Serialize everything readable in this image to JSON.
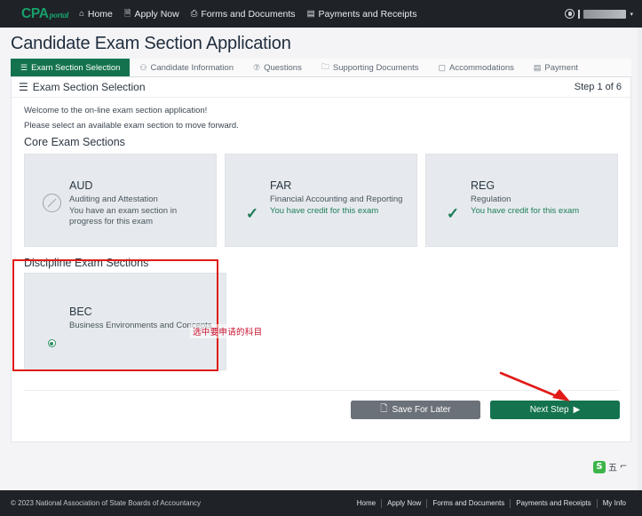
{
  "topnav": {
    "brand_main": "CPA",
    "brand_sub": "portal",
    "items": [
      {
        "icon": "⌂",
        "icon_name": "home-icon",
        "label": "Home"
      },
      {
        "icon": "🗎",
        "icon_name": "document-icon",
        "label": "Apply Now"
      },
      {
        "icon": "⎙",
        "icon_name": "forms-icon",
        "label": "Forms and Documents"
      },
      {
        "icon": "▤",
        "icon_name": "payments-icon",
        "label": "Payments and Receipts"
      }
    ],
    "account_name": "",
    "caret": "▾"
  },
  "page": {
    "title": "Candidate Exam Section Application"
  },
  "tabs": [
    {
      "icon": "☰",
      "label": "Exam Section Selection",
      "active": true
    },
    {
      "icon": "⚇",
      "label": "Candidate Information",
      "active": false
    },
    {
      "icon": "⑦",
      "label": "Questions",
      "active": false
    },
    {
      "icon": "🗀",
      "label": "Supporting Documents",
      "active": false
    },
    {
      "icon": "▢",
      "label": "Accommodations",
      "active": false
    },
    {
      "icon": "▤",
      "label": "Payment",
      "active": false
    }
  ],
  "panel": {
    "header_icon": "☰",
    "header_title": "Exam Section Selection",
    "step_label": "Step 1 of 6",
    "intro_line1": "Welcome to the on-line exam section application!",
    "intro_line2": "Please select an available exam section to move forward.",
    "core_group_title": "Core Exam Sections",
    "discipline_group_title": "Discipline Exam Sections"
  },
  "core_sections": [
    {
      "code": "AUD",
      "name": "Auditing and Attestation",
      "status_text": "You have an exam section in progress for this exam",
      "status_type": "disabled",
      "mark": "no-entry-icon"
    },
    {
      "code": "FAR",
      "name": "Financial Accounting and Reporting",
      "status_text": "You have credit for this exam",
      "status_type": "credit",
      "mark": "check-icon"
    },
    {
      "code": "REG",
      "name": "Regulation",
      "status_text": "You have credit for this exam",
      "status_type": "credit",
      "mark": "check-icon"
    }
  ],
  "discipline_sections": [
    {
      "code": "BEC",
      "name": "Business Environments and Concepts",
      "status_text": "",
      "status_type": "selectable",
      "mark": "radio-selected",
      "selected": true
    }
  ],
  "buttons": {
    "save_icon": "🗋",
    "save_label": "Save For Later",
    "next_label": "Next Step",
    "next_icon": "▶"
  },
  "annotations": {
    "chinese_note": "选中要申请的科目",
    "box_color": "#e01b18",
    "arrow_color": "#e01b18"
  },
  "ime": {
    "logo_letter": "S",
    "mode_label": "五",
    "extra_glyph": "⌐"
  },
  "footer": {
    "copyright": "© 2023 National Association of State Boards of Accountancy",
    "links": [
      "Home",
      "Apply Now",
      "Forms and Documents",
      "Payments and Receipts",
      "My Info"
    ]
  },
  "colors": {
    "brand_green": "#17a06a",
    "accent_green": "#14734e",
    "nav_dark": "#1f2328",
    "card_gray": "#e6eaee",
    "annotation_red": "#e01b18"
  }
}
